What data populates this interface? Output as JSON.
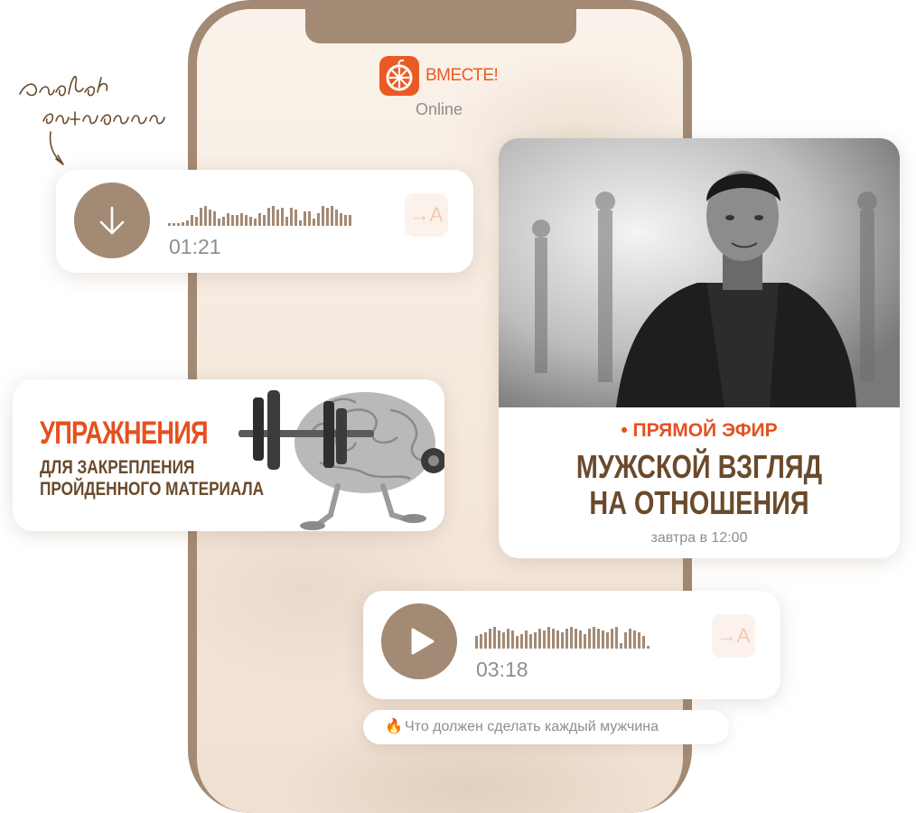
{
  "header": {
    "brand": "ВМЕСТЕ!",
    "status": "Online",
    "logo_icon": "orange-slice-icon",
    "brand_color": "#ea5a24"
  },
  "annotation": {
    "handwritten_note": "Разбор ситуации"
  },
  "voice_messages": [
    {
      "icon": "download-arrow-icon",
      "duration": "01:21",
      "translate_label": "→A"
    },
    {
      "icon": "play-icon",
      "duration": "03:18",
      "translate_label": "→A"
    }
  ],
  "exercise_card": {
    "title": "УПРАЖНЕНИЯ",
    "subtitle_line1": "ДЛЯ ЗАКРЕПЛЕНИЯ",
    "subtitle_line2": "ПРОЙДЕННОГО МАТЕРИАЛА",
    "image_icon": "brain-dumbbell-illustration"
  },
  "live_card": {
    "tag": "• ПРЯМОЙ ЭФИР",
    "title_line1": "МУЖСКОЙ ВЗГЛЯД",
    "title_line2": "НА ОТНОШЕНИЯ",
    "time": "завтра в 12:00",
    "photo": "host-portrait-photo"
  },
  "caption": {
    "icon": "fire-icon",
    "glyph": "🔥",
    "text": "Что должен сделать каждый мужчина"
  },
  "colors": {
    "accent": "#e6501e",
    "brown": "#a38a74",
    "dark_brown": "#6a4a2c",
    "muted": "#8e8e8e"
  }
}
